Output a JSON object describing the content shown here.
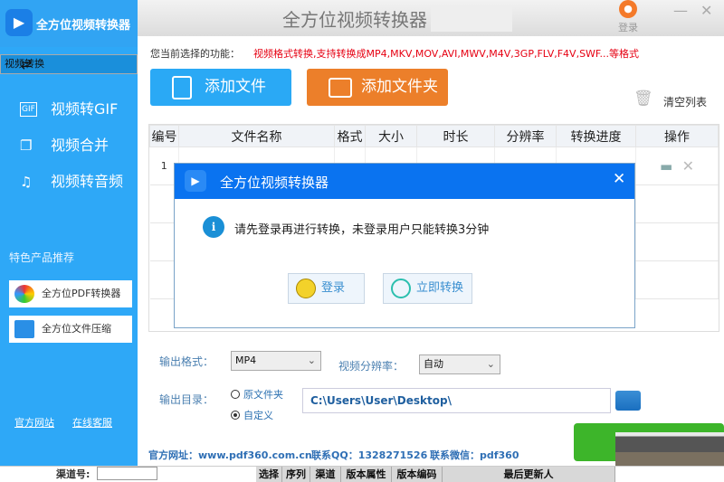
{
  "app": {
    "name": "全方位视频转换器",
    "title": "全方位视频转换器",
    "login": "登录",
    "minimize": "—",
    "close": "✕"
  },
  "sidebar": {
    "items": [
      {
        "label": "视频转换",
        "icon": "convert-icon",
        "selected": true
      },
      {
        "label": "视频转GIF",
        "icon": "gif-icon"
      },
      {
        "label": "视频合并",
        "icon": "merge-icon"
      },
      {
        "label": "视频转音频",
        "icon": "music-icon"
      }
    ],
    "promo_title": "特色产品推荐",
    "promos": [
      {
        "label": "全方位PDF转换器"
      },
      {
        "label": "全方位文件压缩"
      }
    ],
    "links": [
      "官方网站",
      "在线客服"
    ]
  },
  "main": {
    "hint_label": "您当前选择的功能：",
    "hint": "视频格式转换,支持转换成MP4,MKV,MOV,AVI,MWV,M4V,3GP,FLV,F4V,SWF...等格式",
    "add_file": "添加文件",
    "add_folder": "添加文件夹",
    "clear_list": "清空列表",
    "colors": {
      "add_file": "#2aa9f5",
      "add_folder": "#ec7f2a",
      "accent": "#0a73f0"
    }
  },
  "table": {
    "headers": [
      "编号",
      "文件名称",
      "格式",
      "大小",
      "时长",
      "分辨率",
      "转换进度",
      "操作"
    ],
    "rows": [
      {
        "index": "1"
      }
    ]
  },
  "dialog": {
    "title": "全方位视频转换器",
    "message": "请先登录再进行转换，未登录用户只能转换3分钟",
    "login": "登录",
    "convert_now": "立即转换",
    "close": "✕"
  },
  "output": {
    "format_label": "输出格式：",
    "format": "MP4",
    "resolution_label": "视频分辨率：",
    "resolution": "自动",
    "dir_label": "输出目录：",
    "radio_original": "原文件夹",
    "radio_custom": "自定义",
    "radio_selected": "custom",
    "path": "C:\\Users\\User\\Desktop\\"
  },
  "footer": {
    "site": "官方网址：www.pdf360.com.cn",
    "qq": "联系QQ：1328271526",
    "wechat": "联系微信：pdf360"
  },
  "bottom": {
    "channel_label": "渠道号:",
    "headers": [
      "选择",
      "序列",
      "渠道",
      "版本属性",
      "版本编码",
      "最后更新人"
    ]
  }
}
